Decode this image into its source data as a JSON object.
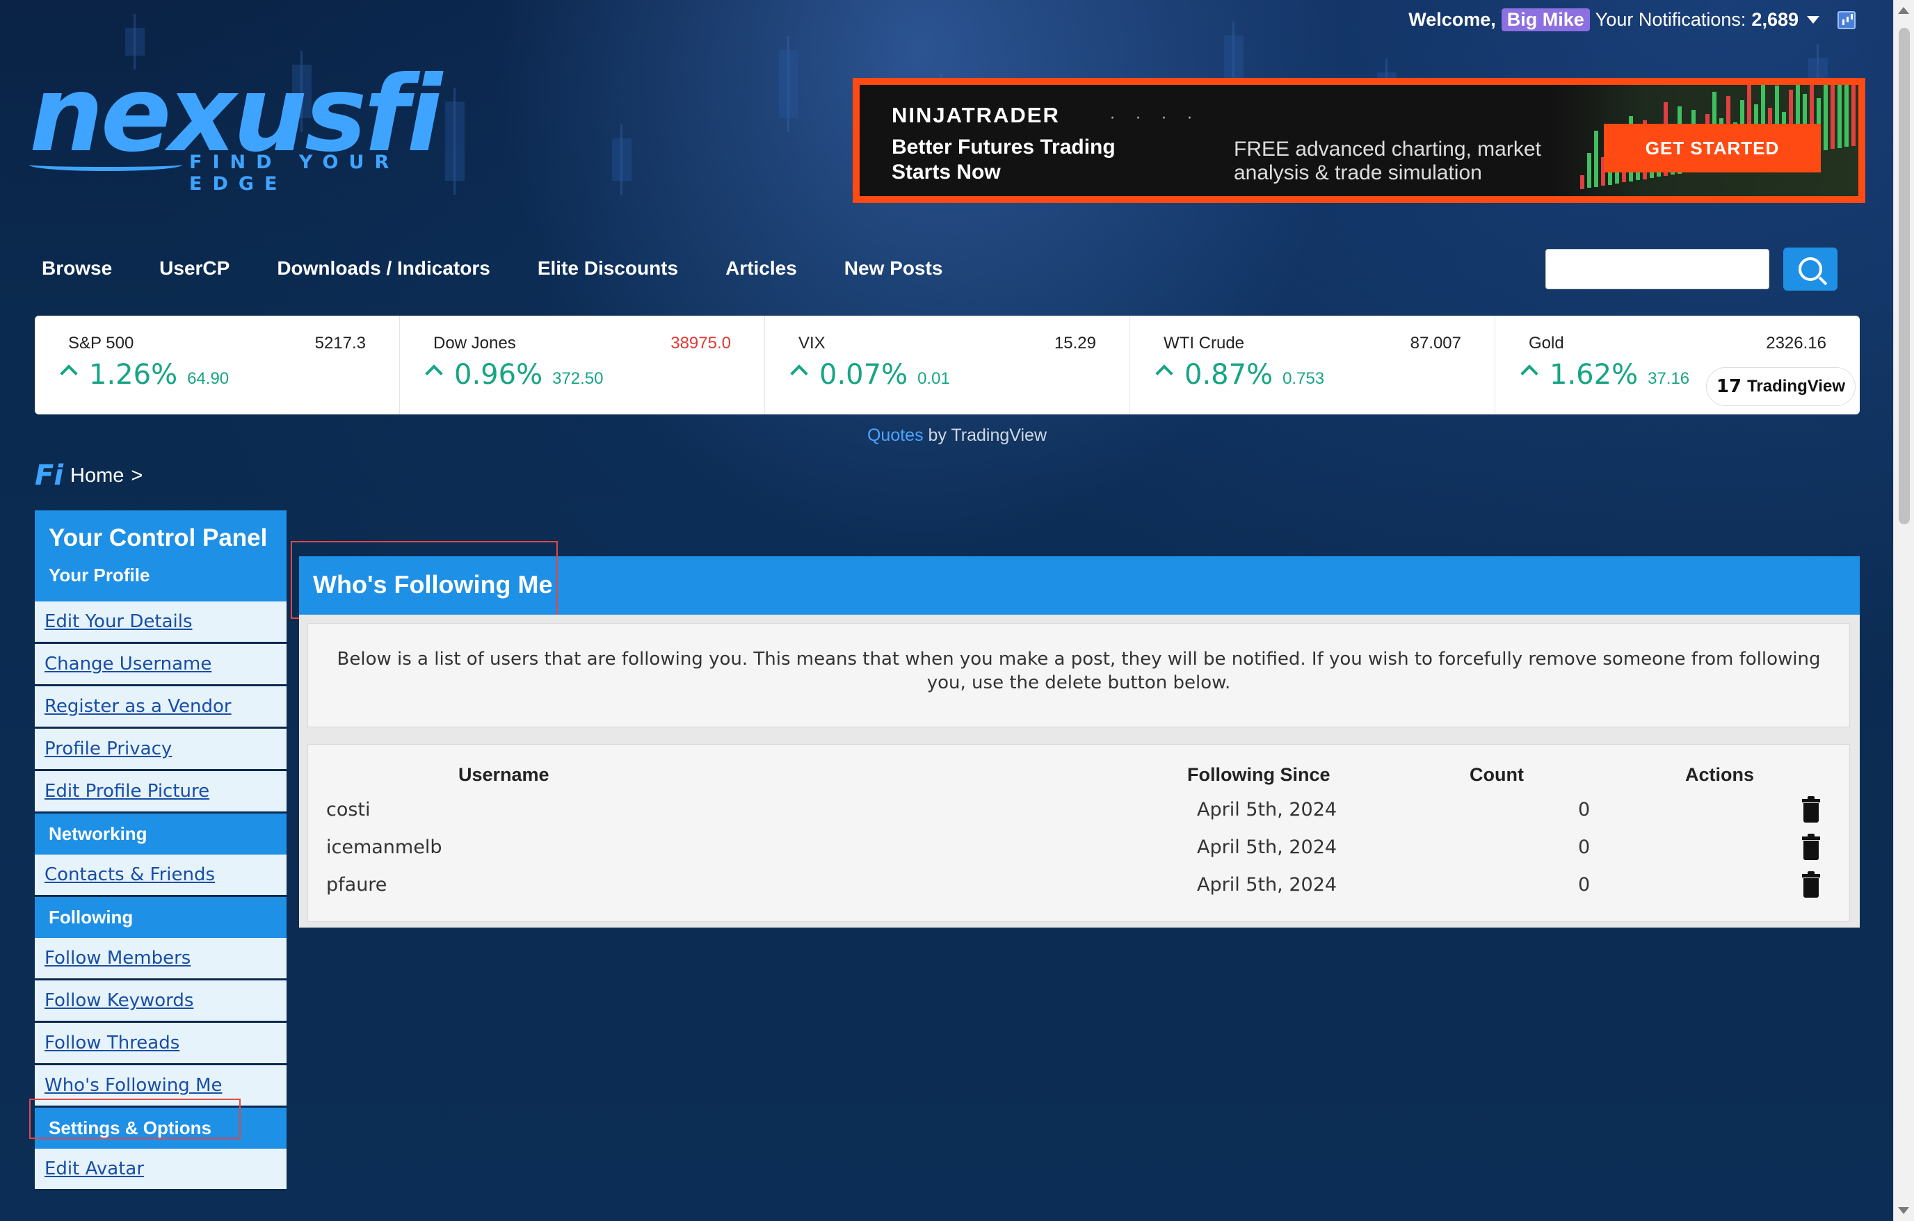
{
  "header": {
    "welcome_label": "Welcome,",
    "username": "Big Mike",
    "notifications_label": "Your Notifications:",
    "notifications_count": "2,689"
  },
  "logo": {
    "name": "nexusfi",
    "tagline": "FIND YOUR EDGE"
  },
  "ad": {
    "brand": "NINJATRADER",
    "headline": "Better Futures Trading Starts Now",
    "description": "FREE advanced charting, market analysis & trade simulation",
    "cta": "GET STARTED",
    "accent": "#ff4a14"
  },
  "nav": {
    "items": [
      "Browse",
      "UserCP",
      "Downloads / Indicators",
      "Elite Discounts",
      "Articles",
      "New Posts"
    ]
  },
  "search": {
    "placeholder": ""
  },
  "ticker": {
    "items": [
      {
        "name": "S&P 500",
        "price": "5217.3",
        "pct": "1.26%",
        "change": "64.90",
        "price_color": "normal"
      },
      {
        "name": "Dow Jones",
        "price": "38975.0",
        "pct": "0.96%",
        "change": "372.50",
        "price_color": "red"
      },
      {
        "name": "VIX",
        "price": "15.29",
        "pct": "0.07%",
        "change": "0.01",
        "price_color": "normal"
      },
      {
        "name": "WTI Crude",
        "price": "87.007",
        "pct": "0.87%",
        "change": "0.753",
        "price_color": "normal"
      },
      {
        "name": "Gold",
        "price": "2326.16",
        "pct": "1.62%",
        "change": "37.16",
        "price_color": "normal"
      }
    ],
    "badge": "TradingView",
    "badge_logo": "17",
    "up_color": "#17a584"
  },
  "quotes": {
    "link": "Quotes",
    "suffix": " by TradingView"
  },
  "breadcrumb": {
    "icon": "Fi",
    "home": "Home",
    "sep": ">"
  },
  "sidebar": {
    "title": "Your Control Panel",
    "sections": [
      {
        "label": "Your Profile",
        "items": [
          "Edit Your Details",
          "Change Username",
          "Register as a Vendor",
          "Profile Privacy",
          "Edit Profile Picture"
        ]
      },
      {
        "label": "Networking",
        "items": [
          "Contacts & Friends"
        ]
      },
      {
        "label": "Following",
        "items": [
          "Follow Members",
          "Follow Keywords",
          "Follow Threads",
          "Who's Following Me"
        ]
      },
      {
        "label": "Settings & Options",
        "items": [
          "Edit Avatar"
        ]
      }
    ]
  },
  "main": {
    "title": "Who's Following Me",
    "description": "Below is a list of users that are following you. This means that when you make a post, they will be notified. If you wish to forcefully remove someone from following you, use the delete button below.",
    "columns": [
      "Username",
      "Following Since",
      "Count",
      "Actions"
    ],
    "rows": [
      {
        "username": "costi",
        "since": "April 5th, 2024",
        "count": "0"
      },
      {
        "username": "icemanmelb",
        "since": "April 5th, 2024",
        "count": "0"
      },
      {
        "username": "pfaure",
        "since": "April 5th, 2024",
        "count": "0"
      }
    ]
  }
}
